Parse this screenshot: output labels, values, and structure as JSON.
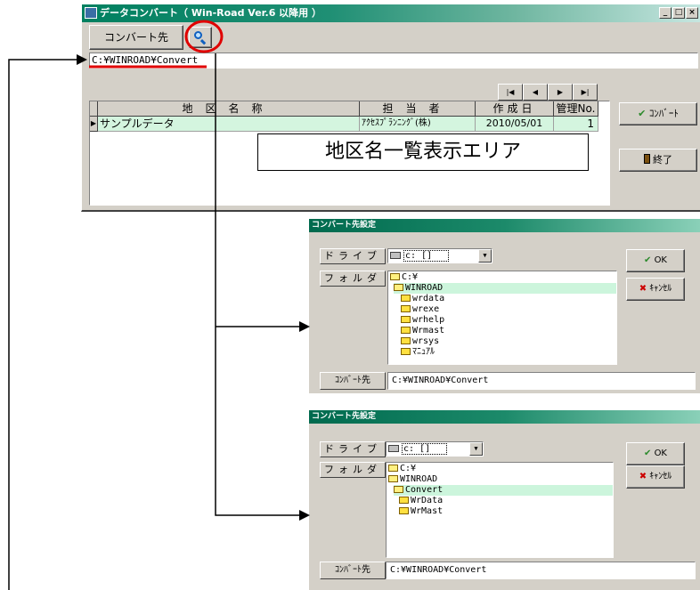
{
  "main_window": {
    "title": "データコンバート（ Win-Road Ver.6 以降用 ）",
    "window_buttons": [
      "_",
      "□",
      "×"
    ],
    "convert_dest_tab": "コンバート先",
    "path_value": "C:¥WINROAD¥Convert",
    "nav_buttons": [
      "|◀",
      "◀",
      "▶",
      "▶|"
    ],
    "grid": {
      "columns": [
        "地区名称",
        "担当者",
        "作成日",
        "管理No."
      ],
      "rows": [
        {
          "district": "サンプルデータ",
          "person": "ｱｸｾｽﾌﾟﾗﾝﾆﾝｸﾞ(株)",
          "date": "2010/05/01",
          "no": "1"
        }
      ]
    },
    "area_label": "地区名一覧表示エリア",
    "convert_button": "ｺﾝﾊﾞｰﾄ",
    "exit_button": "終了"
  },
  "dialog1": {
    "title": "コンバート先設定",
    "drive_label": "ドライブ",
    "drive_value": "c: []",
    "folder_label": "フォルダ",
    "folders": [
      {
        "name": "C:¥",
        "open": true,
        "selected": false
      },
      {
        "name": "WINROAD",
        "open": true,
        "selected": true
      },
      {
        "name": "wrdata",
        "open": false,
        "selected": false
      },
      {
        "name": "wrexe",
        "open": false,
        "selected": false
      },
      {
        "name": "wrhelp",
        "open": false,
        "selected": false
      },
      {
        "name": "Wrmast",
        "open": false,
        "selected": false
      },
      {
        "name": "wrsys",
        "open": false,
        "selected": false
      },
      {
        "name": "ﾏﾆｭｱﾙ",
        "open": false,
        "selected": false
      }
    ],
    "ok_button": "OK",
    "cancel_button": "ｷｬﾝｾﾙ",
    "dest_label": "ｺﾝﾊﾞｰﾄ先",
    "dest_value": "C:¥WINROAD¥Convert"
  },
  "dialog2": {
    "title": "コンバート先設定",
    "drive_label": "ドライブ",
    "drive_value": "c: []",
    "folder_label": "フォルダ",
    "folders": [
      {
        "name": "C:¥",
        "open": true,
        "selected": false
      },
      {
        "name": "WINROAD",
        "open": true,
        "selected": false
      },
      {
        "name": "Convert",
        "open": true,
        "selected": true
      },
      {
        "name": "WrData",
        "open": false,
        "selected": false
      },
      {
        "name": "WrMast",
        "open": false,
        "selected": false
      }
    ],
    "ok_button": "OK",
    "cancel_button": "ｷｬﾝｾﾙ",
    "dest_label": "ｺﾝﾊﾞｰﾄ先",
    "dest_value": "C:¥WINROAD¥Convert"
  },
  "colors": {
    "title_green": "#008060",
    "highlight_row": "#d4f5df",
    "annotation_red": "#e00000"
  }
}
